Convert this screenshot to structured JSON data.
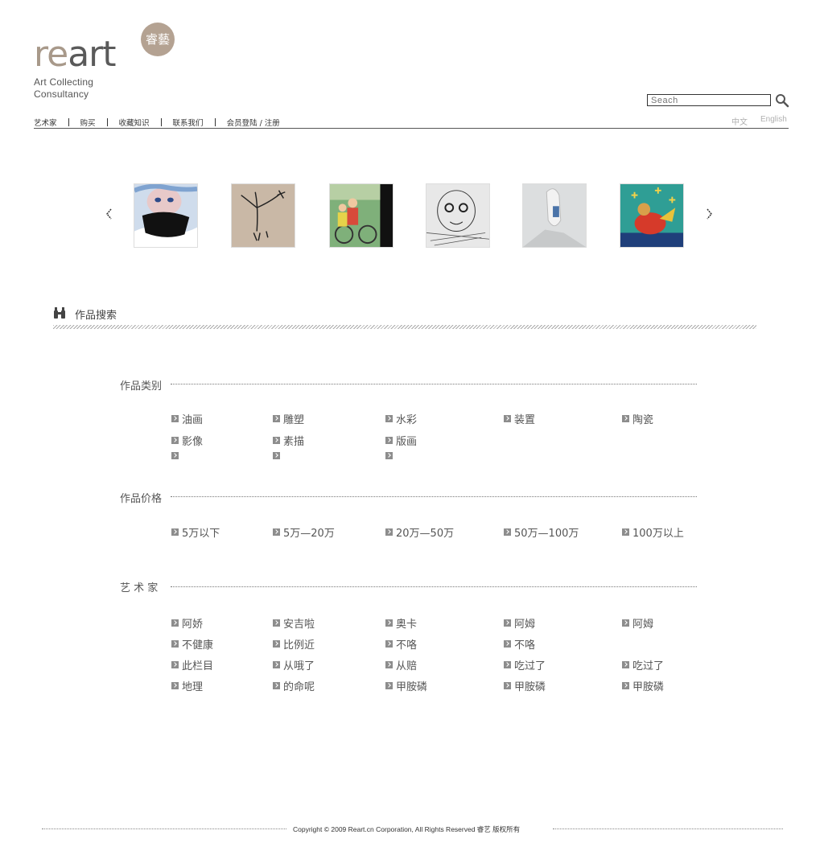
{
  "logo": {
    "word_re": "re",
    "word_art": "art",
    "seal_text": "睿藝",
    "tagline_line1": "Art Collecting",
    "tagline_line2": "Consultancy"
  },
  "search": {
    "placeholder": "Seach",
    "icon": "magnifier-icon"
  },
  "nav": {
    "items": [
      "艺术家",
      "购买",
      "收藏知识",
      "联系我们",
      "会员登陆 / 注册"
    ]
  },
  "lang": {
    "zh": "中文",
    "en": "English"
  },
  "carousel": {
    "prev_icon": "chevron-left-icon",
    "next_icon": "chevron-right-icon",
    "thumbs": [
      "painting-girl-face",
      "sketch-figure",
      "painting-bicycle-riders",
      "etching-child-face",
      "painting-pale-figure",
      "painting-red-figure-planes"
    ]
  },
  "search_section": {
    "title": "作品搜索",
    "icon": "binoculars-icon"
  },
  "groups": [
    {
      "title": "作品类别",
      "options": [
        "油画",
        "雕塑",
        "水彩",
        "装置",
        "陶瓷",
        "影像",
        "素描",
        "版画",
        "",
        "",
        "",
        "",
        ""
      ]
    },
    {
      "title": "作品价格",
      "options": [
        "5万以下",
        "5万—20万",
        "20万—50万",
        "50万—100万",
        "100万以上"
      ]
    },
    {
      "title": "艺 术 家",
      "options": [
        "阿娇",
        "安吉啦",
        "奥卡",
        "阿姆",
        "阿姆",
        "不健康",
        "比例近",
        "不咯",
        "不咯",
        "",
        "此栏目",
        "从哦了",
        "从赔",
        "吃过了",
        "吃过了",
        "地理",
        "的命呢",
        "甲胺磷",
        "甲胺磷",
        "甲胺磷"
      ]
    }
  ],
  "footer": {
    "copyright": "Copyright © 2009 Reart.cn Corporation, All Rights Reserved 睿艺 版权所有"
  },
  "colors": {
    "logo_re": "#a8998a",
    "logo_art": "#5a5a5a",
    "seal": "#b4a292",
    "text": "#555555",
    "muted": "#b0b0b0"
  }
}
